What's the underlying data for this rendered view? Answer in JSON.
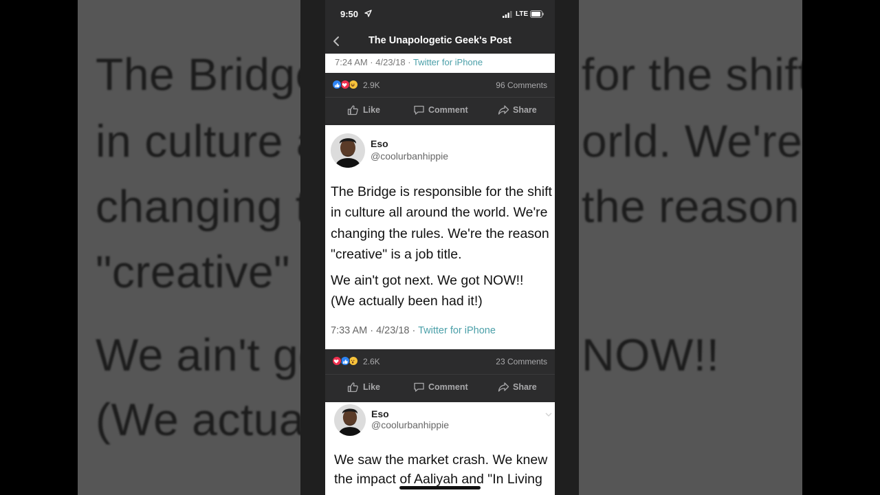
{
  "background_text": {
    "lines": [
      "The Bridge",
      "for the shift",
      "in culture a",
      "orld. We're",
      "changing th",
      "the reason",
      "\"creative\" is",
      "We ain't go",
      "NOW!!",
      "(We actuall"
    ]
  },
  "status_bar": {
    "time": "9:50",
    "network": "LTE"
  },
  "nav": {
    "title": "The Unapologetic Geek's Post"
  },
  "top_strip": {
    "time": "7:24 AM · 4/23/18 · ",
    "source": "Twitter for iPhone"
  },
  "post1_bar": {
    "reaction_count": "2.9K",
    "comments": "96 Comments"
  },
  "actions": {
    "like": "Like",
    "comment": "Comment",
    "share": "Share"
  },
  "tweet1": {
    "name": "Eso",
    "handle": "@coolurbanhippie",
    "text_lines": [
      "The Bridge is responsible for the shift",
      "in culture all around the world. We're",
      "changing the rules. We're the reason",
      "\"creative\" is a job title.",
      "We ain't got next. We got NOW!!",
      "(We actually been had it!)"
    ],
    "time": "7:33 AM · 4/23/18 · ",
    "source": "Twitter for iPhone"
  },
  "post2_bar": {
    "reaction_count": "2.6K",
    "comments": "23 Comments"
  },
  "tweet2": {
    "name": "Eso",
    "handle": "@coolurbanhippie",
    "text_lines": [
      "We saw the market crash. We knew",
      "the impact of Aaliyah and \"In Living"
    ]
  },
  "colors": {
    "link": "#4a9fa8",
    "like": "#2d84f5",
    "love": "#f0304f",
    "haha": "#f7c33b"
  }
}
